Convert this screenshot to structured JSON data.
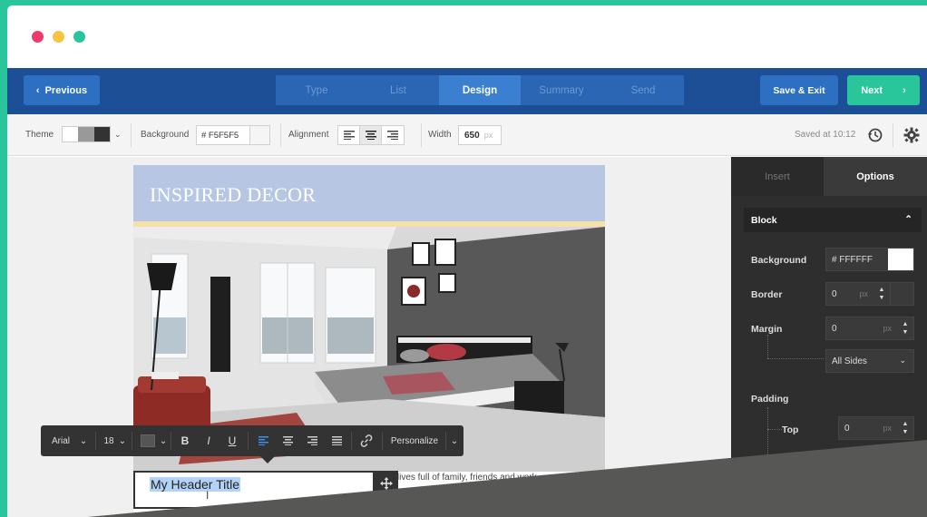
{
  "topnav": {
    "previous_label": "Previous",
    "steps": [
      {
        "label": "Type",
        "active": false
      },
      {
        "label": "List",
        "active": false
      },
      {
        "label": "Design",
        "active": true
      },
      {
        "label": "Summary",
        "active": false
      },
      {
        "label": "Send",
        "active": false
      }
    ],
    "save_exit_label": "Save & Exit",
    "next_label": "Next"
  },
  "toolbar": {
    "theme_label": "Theme",
    "background_label": "Background",
    "background_value": "# F5F5F5",
    "alignment_label": "Alignment",
    "width_label": "Width",
    "width_value": "650",
    "width_unit": "px",
    "saved_text": "Saved at 10:12"
  },
  "email": {
    "brand": "INSPIRED DECOR",
    "body_line_1": "busy lives full of family, friends and work",
    "header_title_value": "My Header Title"
  },
  "format_bar": {
    "font": "Arial",
    "size": "18",
    "bold": "B",
    "italic": "I",
    "underline": "U",
    "personalize": "Personalize"
  },
  "panel": {
    "tab_insert": "Insert",
    "tab_options": "Options",
    "block_label": "Block",
    "background_label": "Background",
    "background_value": "# FFFFFF",
    "border_label": "Border",
    "border_value": "0",
    "margin_label": "Margin",
    "margin_value": "0",
    "margin_sides": "All Sides",
    "padding_label": "Padding",
    "top_label": "Top",
    "top_value": "0",
    "unit": "px"
  },
  "colors": {
    "nav": "#1c4f96",
    "accent": "#2ac69b",
    "header_bg": "#b7c6e3",
    "panel": "#2e2e2e"
  }
}
